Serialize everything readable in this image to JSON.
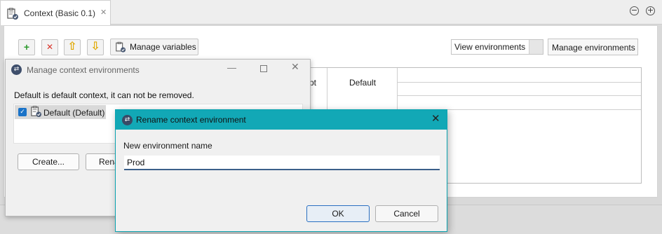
{
  "editor": {
    "tab_title": "Context (Basic 0.1)",
    "tab_close": "✕",
    "minimize": "−",
    "maximize": "+",
    "toolbar": {
      "add": "+",
      "remove": "✕",
      "move_up": "⇧",
      "move_down": "⇩",
      "manage_variables": "Manage variables"
    },
    "view_environments": "View environments",
    "manage_environments": "Manage environments",
    "table_headers": [
      "pt",
      "Default"
    ]
  },
  "manage_dialog": {
    "title": "Manage context environments",
    "min": "—",
    "close": "✕",
    "description": "Default is default context, it can not be removed.",
    "environments": [
      {
        "label": "Default (Default)",
        "checked": true
      }
    ],
    "create_label": "Create...",
    "rename_label": "Rena"
  },
  "rename_dialog": {
    "title": "Rename context environment",
    "close": "✕",
    "field_label": "New environment name",
    "field_value": "Prod",
    "ok_label": "OK",
    "cancel_label": "Cancel"
  },
  "colors": {
    "accent": "#12a8b6",
    "add_green": "#2e9a2e",
    "remove_red": "#d9342b",
    "arrow_yellow": "#e0a800",
    "checkbox_blue": "#1a73c8"
  },
  "icons": {
    "context": "clipboard-check-icon",
    "dialog": "talend-app-icon"
  }
}
